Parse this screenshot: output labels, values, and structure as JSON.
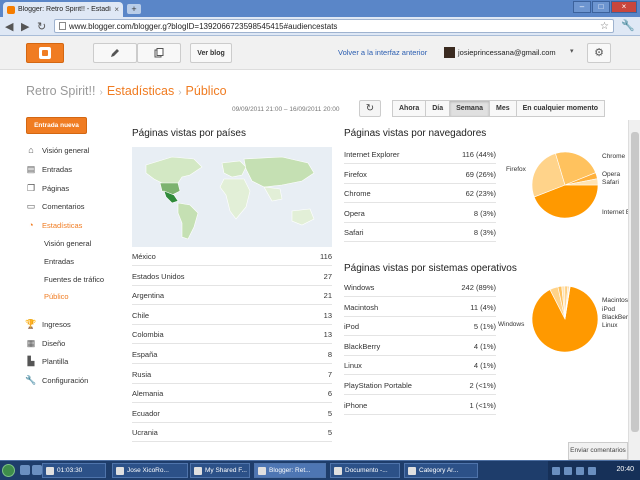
{
  "browser": {
    "tab_title": "Blogger: Retro Spirit!! - Estadí",
    "new_tab": "+",
    "back": "◀",
    "forward": "▶",
    "reload": "↻",
    "url": "www.blogger.com/blogger.g?blogID=1392066723598545415#audiencestats",
    "bookmark_icon": "star-icon",
    "menu_icon": "wrench-icon"
  },
  "blogger_bar": {
    "view_blog": "Ver blog",
    "old_interface_link": "Volver a la interfaz anterior",
    "user_email": "josieprincessana@gmail.com",
    "caret": "▾",
    "gear": "⚙"
  },
  "header": {
    "blog_name": "Retro Spirit!!",
    "section": "Estadísticas",
    "subsection": "Público",
    "separator": "›",
    "date_range": "09/09/2011 21:00 – 16/09/2011 20:00",
    "refresh": "↻",
    "ranges": [
      "Ahora",
      "Día",
      "Semana",
      "Mes",
      "En cualquier momento"
    ],
    "active_range": "Semana"
  },
  "sidebar": {
    "new_post": "Entrada nueva",
    "items": [
      {
        "label": "Visión general",
        "icon": "home-icon"
      },
      {
        "label": "Entradas",
        "icon": "posts-icon"
      },
      {
        "label": "Páginas",
        "icon": "pages-icon"
      },
      {
        "label": "Comentarios",
        "icon": "comments-icon"
      },
      {
        "label": "Estadísticas",
        "icon": "stats-icon"
      },
      {
        "label": "Ingresos",
        "icon": "earnings-icon"
      },
      {
        "label": "Diseño",
        "icon": "layout-icon"
      },
      {
        "label": "Plantilla",
        "icon": "template-icon"
      },
      {
        "label": "Configuración",
        "icon": "settings-icon"
      }
    ],
    "stats_sub": [
      "Visión general",
      "Entradas",
      "Fuentes de tráfico",
      "Público"
    ]
  },
  "countries": {
    "title": "Páginas vistas por países",
    "rows": [
      {
        "label": "México",
        "value": "116"
      },
      {
        "label": "Estados Unidos",
        "value": "27"
      },
      {
        "label": "Argentina",
        "value": "21"
      },
      {
        "label": "Chile",
        "value": "13"
      },
      {
        "label": "Colombia",
        "value": "13"
      },
      {
        "label": "España",
        "value": "8"
      },
      {
        "label": "Rusia",
        "value": "7"
      },
      {
        "label": "Alemania",
        "value": "6"
      },
      {
        "label": "Ecuador",
        "value": "5"
      },
      {
        "label": "Ucrania",
        "value": "5"
      }
    ]
  },
  "browsers": {
    "title": "Páginas vistas por navegadores",
    "rows": [
      {
        "label": "Internet Explorer",
        "value": "116 (44%)"
      },
      {
        "label": "Firefox",
        "value": "69 (26%)"
      },
      {
        "label": "Chrome",
        "value": "62 (23%)"
      },
      {
        "label": "Opera",
        "value": "8 (3%)"
      },
      {
        "label": "Safari",
        "value": "8 (3%)"
      }
    ],
    "pie_labels": [
      "Chrome",
      "Opera",
      "Safari",
      "Internet E",
      "Firefox"
    ]
  },
  "os": {
    "title": "Páginas vistas por sistemas operativos",
    "rows": [
      {
        "label": "Windows",
        "value": "242 (89%)"
      },
      {
        "label": "Macintosh",
        "value": "11 (4%)"
      },
      {
        "label": "iPod",
        "value": "5 (1%)"
      },
      {
        "label": "BlackBerry",
        "value": "4 (1%)"
      },
      {
        "label": "Linux",
        "value": "4 (1%)"
      },
      {
        "label": "PlayStation Portable",
        "value": "2 (<1%)"
      },
      {
        "label": "iPhone",
        "value": "1 (<1%)"
      }
    ],
    "pie_labels": [
      "Macintos",
      "iPod",
      "BlackBer",
      "Linux",
      "Windows"
    ]
  },
  "colors": {
    "accent": "#f07c22",
    "map_highlight": "#2f8a3a",
    "map_light": "#d3e8c4",
    "pie_main": "#ff9900",
    "pie_light": "#ffd38a"
  },
  "feedback": "Enviar comentarios",
  "taskbar": {
    "time_badge": "01:03:30",
    "tasks": [
      "Jose XicoRo...",
      "My Shared F...",
      "Blogger: Ret...",
      "Documento -...",
      "Category Ar..."
    ],
    "clock": "20:40"
  }
}
